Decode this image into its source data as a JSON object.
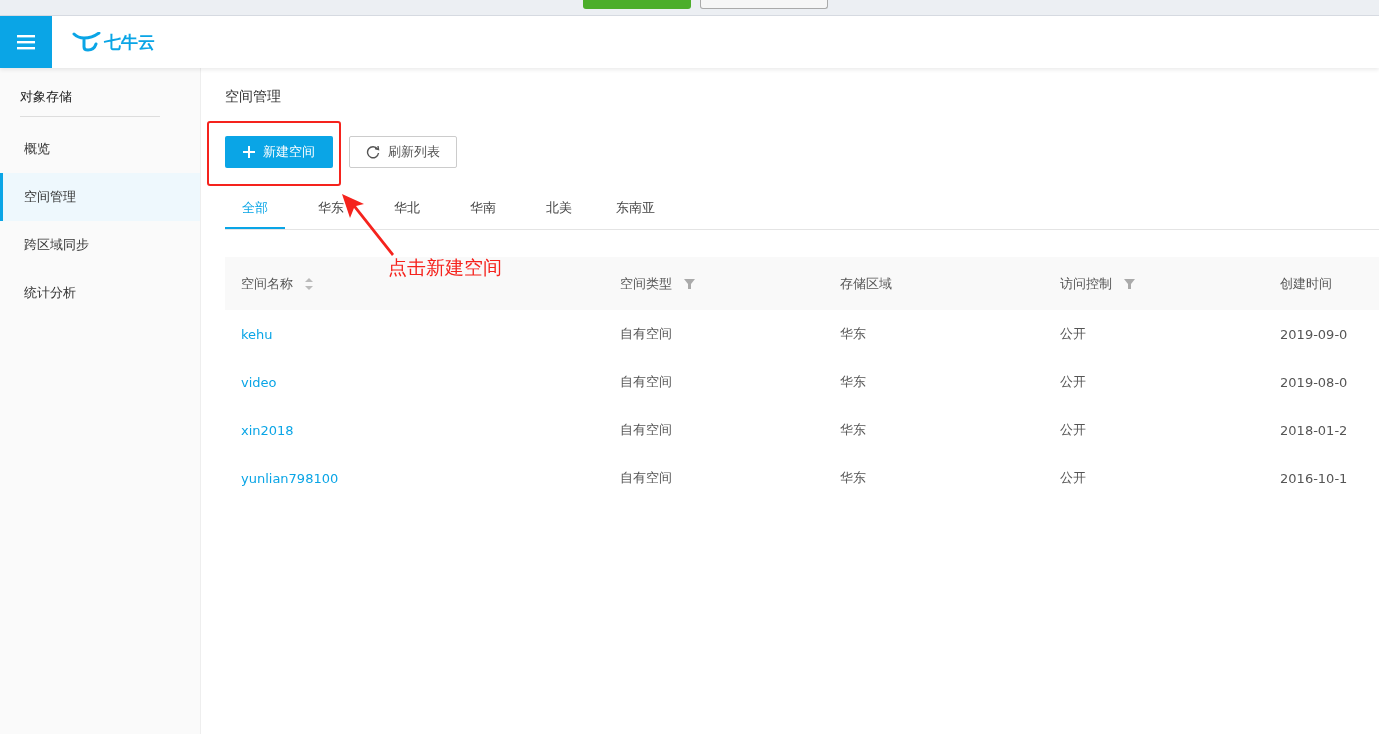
{
  "header": {
    "logo_text": "七牛云"
  },
  "sidebar": {
    "title": "对象存储",
    "items": [
      {
        "label": "概览",
        "selected": false
      },
      {
        "label": "空间管理",
        "selected": true
      },
      {
        "label": "跨区域同步",
        "selected": false
      },
      {
        "label": "统计分析",
        "selected": false
      }
    ]
  },
  "page": {
    "title": "空间管理",
    "buttons": [
      {
        "kind": "primary",
        "label": "新建空间"
      },
      {
        "kind": "refresh",
        "label": "刷新列表"
      }
    ]
  },
  "tabs": [
    {
      "label": "全部",
      "selected": true
    },
    {
      "label": "华东",
      "selected": false
    },
    {
      "label": "华北",
      "selected": false
    },
    {
      "label": "华南",
      "selected": false
    },
    {
      "label": "北美",
      "selected": false
    },
    {
      "label": "东南亚",
      "selected": false
    }
  ],
  "table": {
    "columns": [
      {
        "label": "空间名称",
        "kind": "sort"
      },
      {
        "label": "空间类型",
        "kind": "filter"
      },
      {
        "label": "存储区域",
        "kind": "plain"
      },
      {
        "label": "访问控制",
        "kind": "filter"
      },
      {
        "label": "创建时间",
        "kind": "plain"
      }
    ],
    "rows": [
      [
        "kehu",
        "自有空间",
        "华东",
        "公开",
        "2019-09-0"
      ],
      [
        "video",
        "自有空间",
        "华东",
        "公开",
        "2019-08-0"
      ],
      [
        "xin2018",
        "自有空间",
        "华东",
        "公开",
        "2018-01-2"
      ],
      [
        "yunlian798100",
        "自有空间",
        "华东",
        "公开",
        "2016-10-1"
      ]
    ]
  },
  "annotation": {
    "text": "点击新建空间"
  }
}
